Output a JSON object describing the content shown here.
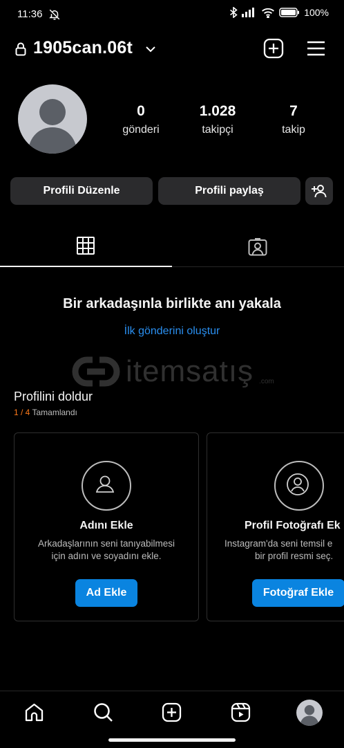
{
  "status_bar": {
    "time": "11:36",
    "battery_percent": "100%"
  },
  "header": {
    "username": "1905can.06t"
  },
  "profile": {
    "stats": [
      {
        "value": "0",
        "label": "gönderi"
      },
      {
        "value": "1.028",
        "label": "takipçi"
      },
      {
        "value": "7",
        "label": "takip"
      }
    ],
    "edit_button": "Profili Düzenle",
    "share_button": "Profili paylaş"
  },
  "empty_state": {
    "title": "Bir arkadaşınla birlikte anı yakala",
    "link": "İlk gönderini oluştur"
  },
  "watermark": {
    "text": "itemsatış",
    "suffix": ".com"
  },
  "complete_profile": {
    "title": "Profilini doldur",
    "progress_count": "1 / 4",
    "progress_label": "Tamamlandı",
    "cards": [
      {
        "title": "Adını Ekle",
        "line1": "Arkadaşlarının seni tanıyabilmesi",
        "line2": "için adını ve soyadını ekle.",
        "button": "Ad Ekle"
      },
      {
        "title": "Profil Fotoğrafı Ek",
        "line1": "Instagram'da seni temsil e",
        "line2": "bir profil resmi seç.",
        "button": "Fotoğraf Ekle"
      }
    ]
  },
  "colors": {
    "accent": "#0a84e0",
    "link": "#2a8ff0",
    "progress": "#ff7a1a",
    "button_bg": "#2b2b2d"
  }
}
